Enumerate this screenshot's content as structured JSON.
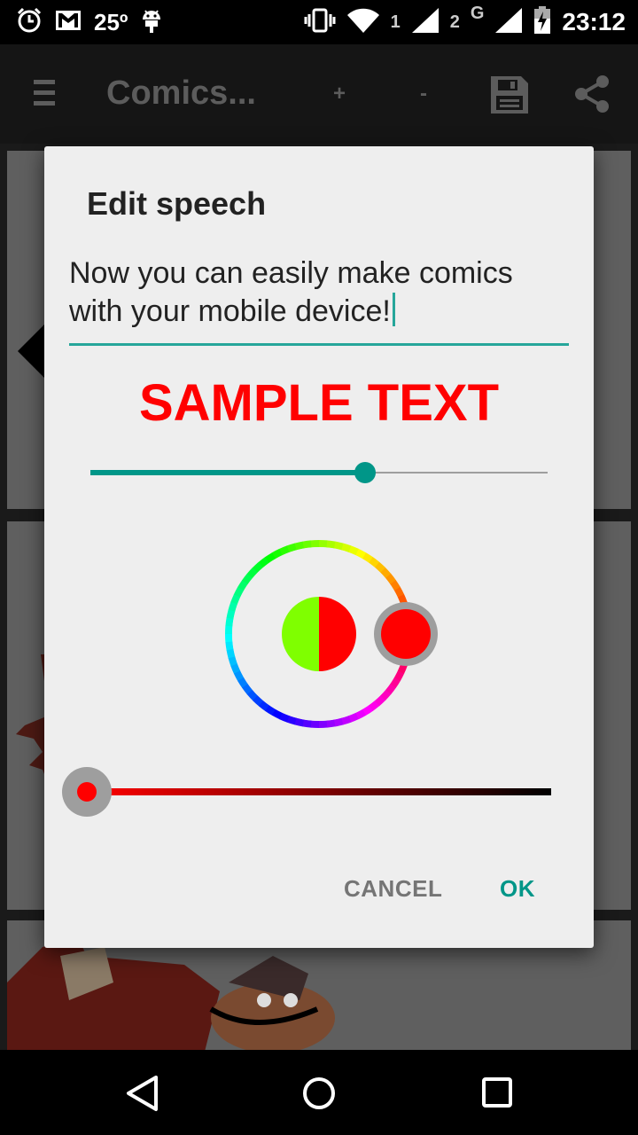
{
  "status_bar": {
    "temperature": "25º",
    "sim1": "1",
    "sim2": "2",
    "network_type": "G",
    "time": "23:12",
    "icons": [
      "alarm-icon",
      "gmail-icon",
      "android-icon",
      "vibrate-icon",
      "wifi-icon",
      "signal-icon",
      "battery-charging-icon"
    ]
  },
  "app_bar": {
    "title": "Comics...",
    "zoom_in_label": "+",
    "zoom_out_label": "-",
    "icons": [
      "menu-icon",
      "save-icon",
      "share-icon"
    ]
  },
  "dialog": {
    "title": "Edit speech",
    "speech_text": "Now you can easily make comics with your mobile device!",
    "sample_text": "SAMPLE TEXT",
    "sample_color": "#ff0000",
    "text_size_fraction": 0.6,
    "color_picker": {
      "old_color": "#7fff00",
      "new_color": "#ff0000",
      "hue_position": "red"
    },
    "lightness_fraction": 0.0,
    "cancel_label": "CANCEL",
    "ok_label": "OK",
    "accent": "#009688"
  },
  "nav_bar": {
    "icons": [
      "back-icon",
      "home-icon",
      "recents-icon"
    ]
  }
}
